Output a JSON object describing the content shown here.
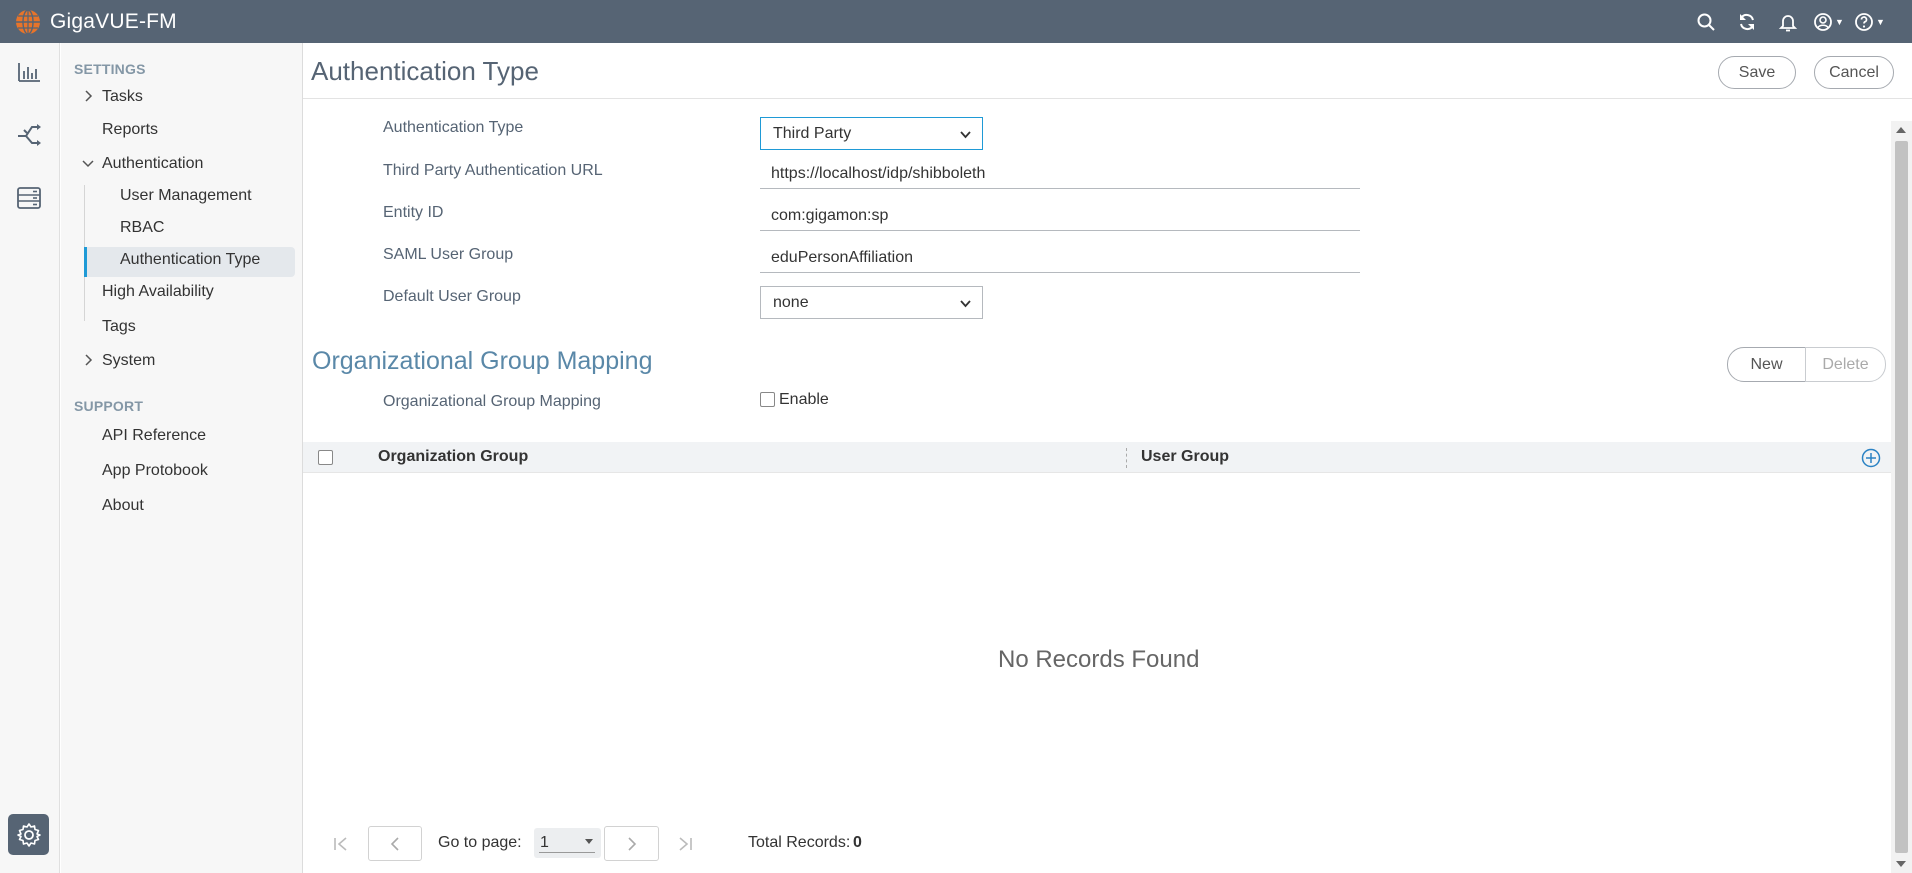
{
  "app": {
    "title": "GigaVUE-FM"
  },
  "topbar": {
    "icons": [
      "search-icon",
      "refresh-icon",
      "bell-icon",
      "user-icon",
      "help-icon"
    ]
  },
  "rail": {
    "icons": [
      "dashboard-icon",
      "traffic-icon",
      "inventory-icon",
      "settings-icon"
    ]
  },
  "nav": {
    "settings_label": "SETTINGS",
    "tasks": "Tasks",
    "reports": "Reports",
    "authentication": "Authentication",
    "user_management": "User Management",
    "rbac": "RBAC",
    "authentication_type": "Authentication Type",
    "high_availability": "High Availability",
    "tags": "Tags",
    "system": "System",
    "support_label": "SUPPORT",
    "api_reference": "API Reference",
    "app_protobook": "App Protobook",
    "about": "About"
  },
  "header": {
    "title": "Authentication Type",
    "save": "Save",
    "cancel": "Cancel"
  },
  "form": {
    "auth_type_label": "Authentication Type",
    "auth_type_value": "Third Party",
    "url_label": "Third Party Authentication URL",
    "url_value": "https://localhost/idp/shibboleth",
    "entity_label": "Entity ID",
    "entity_value": "com:gigamon:sp",
    "saml_label": "SAML User Group",
    "saml_value": "eduPersonAffiliation",
    "default_group_label": "Default User Group",
    "default_group_value": "none"
  },
  "mapping": {
    "title": "Organizational Group Mapping",
    "new": "New",
    "delete": "Delete",
    "row_label": "Organizational Group Mapping",
    "enable": "Enable",
    "columns": [
      "Organization Group",
      "User Group"
    ],
    "empty": "No Records Found"
  },
  "pager": {
    "goto_label": "Go to page:",
    "page": "1",
    "total_label": "Total Records:",
    "total": "0"
  },
  "colors": {
    "topbar": "#566474",
    "accent": "#1f9ad6",
    "section_title": "#5a88a8",
    "label": "#566474"
  }
}
